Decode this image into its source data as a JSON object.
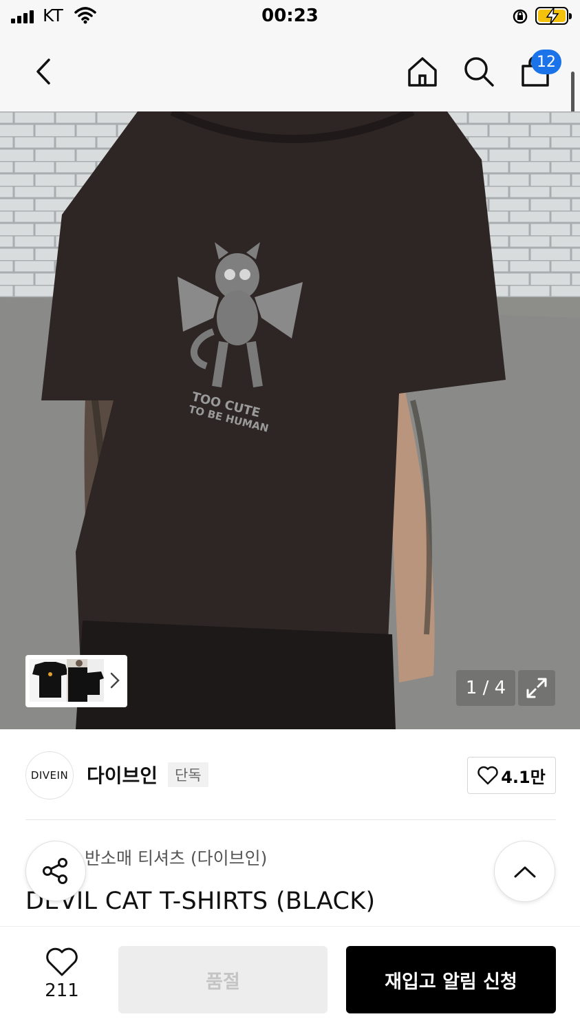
{
  "status_bar": {
    "carrier": "KT",
    "time": "00:23"
  },
  "nav": {
    "back_icon": "chevron-left-icon",
    "home_icon": "home-icon",
    "search_icon": "search-icon",
    "cart_icon": "shopping-bag-icon",
    "cart_badge": "12"
  },
  "gallery": {
    "counter": "1 / 4",
    "progress_current": 1,
    "progress_total": 4,
    "expand_icon": "expand-icon",
    "next_thumb_icon": "chevron-right-icon",
    "shirt_print": {
      "line1": "TOO CUTE",
      "line2": "TO BE HUMAN"
    }
  },
  "brand": {
    "logo_text": "DIVEIN",
    "name": "다이브인",
    "badge": "단독",
    "likes": "4.1만"
  },
  "product": {
    "category": "반소매 티셔츠 (다이브인)",
    "title": "DEVIL CAT T-SHIRTS (BLACK)"
  },
  "bottom_bar": {
    "wish_count": "211",
    "sold_out_label": "품절",
    "restock_label": "재입고 알림 신청"
  },
  "colors": {
    "cart_badge": "#1a73e8",
    "primary_button": "#000000",
    "disabled_button": "#ededed"
  }
}
